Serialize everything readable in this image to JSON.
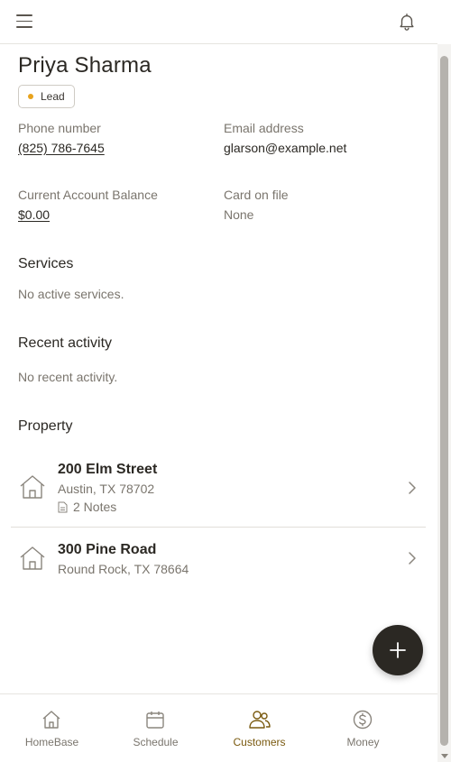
{
  "header": {
    "menu_icon": "hamburger-icon",
    "notifications_icon": "bell-icon"
  },
  "customer": {
    "name": "Priya Sharma",
    "status_badge": {
      "label": "Lead",
      "color": "#e8a31d"
    },
    "phone_label": "Phone number",
    "phone_value": "(825) 786-7645",
    "email_label": "Email address",
    "email_value": "glarson@example.net",
    "balance_label": "Current Account Balance",
    "balance_value": "$0.00",
    "card_label": "Card on file",
    "card_value": "None"
  },
  "services": {
    "title": "Services",
    "empty": "No active services."
  },
  "activity": {
    "title": "Recent activity",
    "empty": "No recent activity."
  },
  "property": {
    "title": "Property",
    "items": [
      {
        "street": "200 Elm Street",
        "city": "Austin, TX 78702",
        "notes": "2 Notes"
      },
      {
        "street": "300 Pine Road",
        "city": "Round Rock, TX 78664"
      }
    ]
  },
  "fab": {
    "icon": "plus-icon"
  },
  "nav": {
    "items": [
      {
        "label": "HomeBase",
        "icon": "home-icon"
      },
      {
        "label": "Schedule",
        "icon": "calendar-icon"
      },
      {
        "label": "Customers",
        "icon": "users-icon",
        "active": true
      },
      {
        "label": "Money",
        "icon": "dollar-circle-icon"
      }
    ]
  },
  "colors": {
    "accent": "#7a5a10",
    "fab": "#2b2823",
    "lead_dot": "#e8a31d"
  }
}
